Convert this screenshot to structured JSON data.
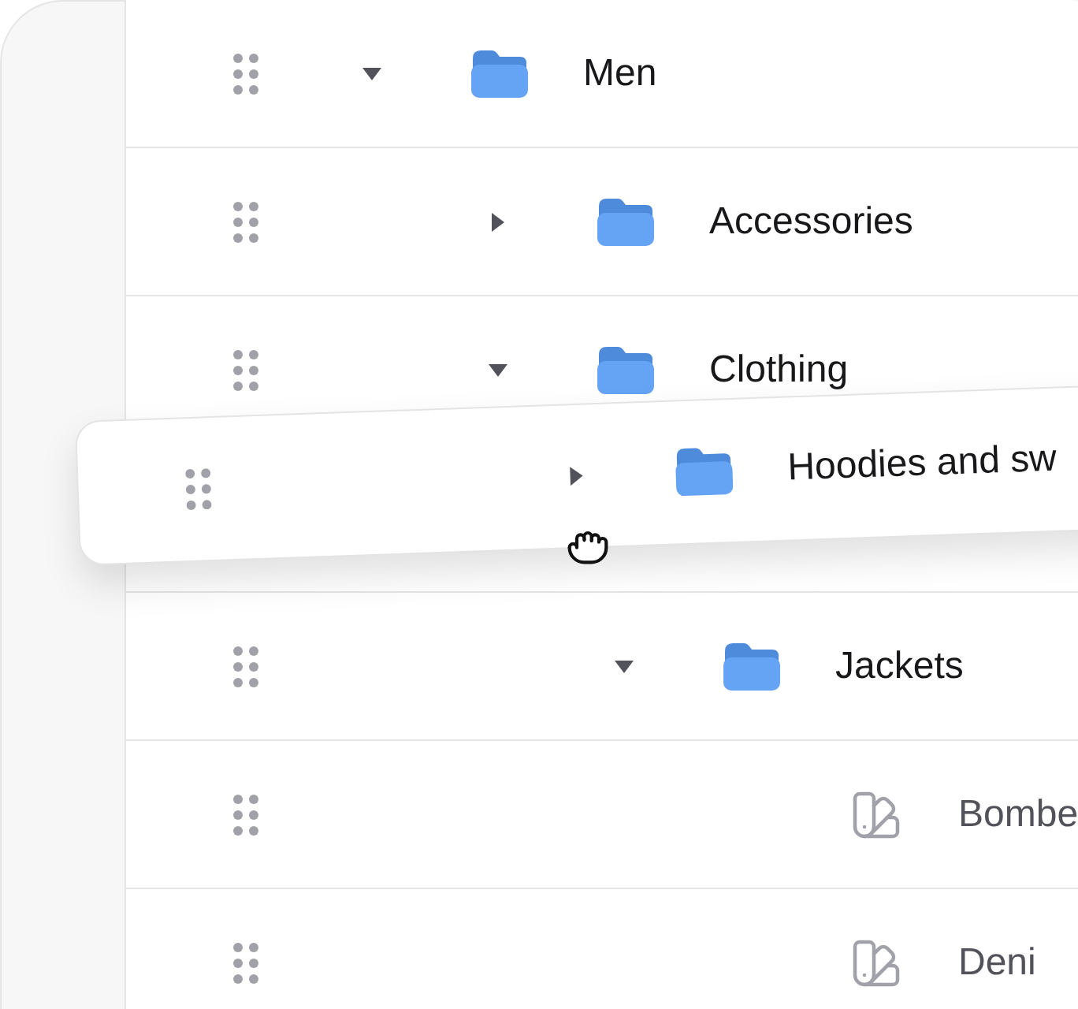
{
  "tree": [
    {
      "label": "Men",
      "kind": "folder",
      "expanded": true,
      "children": [
        {
          "label": "Accessories",
          "kind": "folder",
          "expanded": false
        },
        {
          "label": "Clothing",
          "kind": "folder",
          "expanded": true,
          "drop_slot_after": true,
          "children": [
            {
              "label": "Jackets",
              "kind": "folder",
              "expanded": true,
              "children": [
                {
                  "label": "Bombe",
                  "kind": "leaf"
                },
                {
                  "label": "Deni",
                  "kind": "leaf"
                }
              ]
            }
          ]
        }
      ]
    }
  ],
  "dragged_item": {
    "label": "Hoodies and sw",
    "kind": "folder",
    "expanded": false
  }
}
